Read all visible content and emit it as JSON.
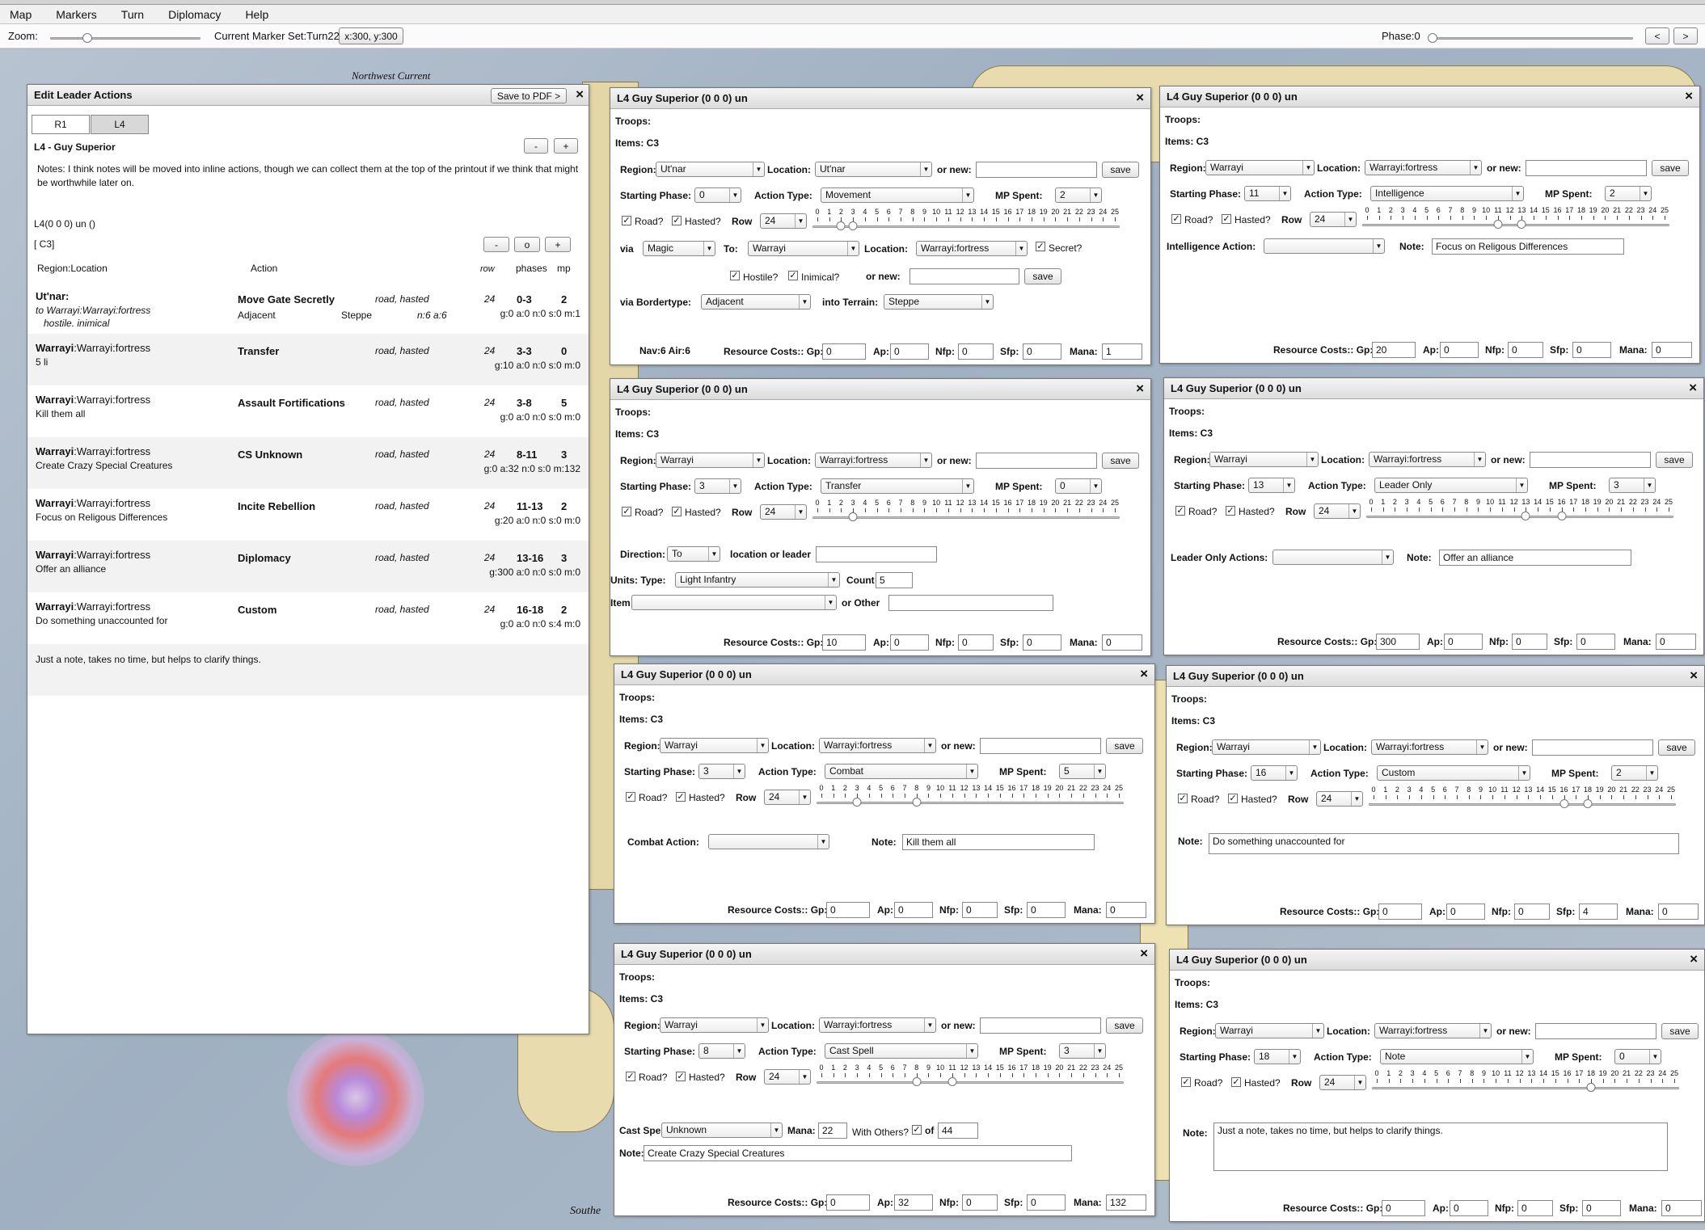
{
  "menu": [
    "Map",
    "Markers",
    "Turn",
    "Diplomacy",
    "Help"
  ],
  "toolbar": {
    "zoom_label": "Zoom:",
    "marker_set": "Current Marker Set:Turn22",
    "coords": "x:300, y:300",
    "phase_label": "Phase:0",
    "prev": "<",
    "next": ">"
  },
  "map_labels": {
    "current": "Northwest Current",
    "south": "Southe"
  },
  "leader": {
    "title": "Edit Leader Actions",
    "pdf": "Save to PDF >",
    "close": "×",
    "tabs": [
      "R1",
      "L4"
    ],
    "name": "L4 - Guy Superior",
    "minus": "-",
    "plus": "+",
    "notes": "Notes: I think notes will be moved into inline actions, though we can collect them at the top of the printout if we think that might be worthwhile later on.",
    "unit": "L4(0 0 0) un ()",
    "items": "[ C3]",
    "zero": "o",
    "hdr": {
      "region": "Region:",
      "location": "Location",
      "action": "Action",
      "row": "row",
      "phases": "phases",
      "mp": "mp"
    },
    "rows": [
      {
        "region": "Ut'nar:",
        "loc": "",
        "note": "to Warrayi:Warrayi:fortress",
        "extra": "hostile. inimical",
        "action": "Move Gate Secretly",
        "mods": "road, hasted",
        "row": "24",
        "phases": "0-3",
        "mp": "2",
        "sub1": "Adjacent",
        "sub2": "Steppe",
        "sub3": "n:6 a:6",
        "res": "g:0 a:0 n:0 s:0 m:1"
      },
      {
        "region": "Warrayi",
        "loc": ":Warrayi:fortress",
        "note": "5 li",
        "extra": "",
        "action": "Transfer",
        "mods": "road, hasted",
        "row": "24",
        "phases": "3-3",
        "mp": "0",
        "sub1": "",
        "sub2": "",
        "sub3": "",
        "res": "g:10 a:0 n:0 s:0 m:0"
      },
      {
        "region": "Warrayi",
        "loc": ":Warrayi:fortress",
        "note": "Kill them all",
        "extra": "",
        "action": "Assault Fortifications",
        "mods": "road, hasted",
        "row": "24",
        "phases": "3-8",
        "mp": "5",
        "sub1": "",
        "sub2": "",
        "sub3": "",
        "res": "g:0 a:0 n:0 s:0 m:0"
      },
      {
        "region": "Warrayi",
        "loc": ":Warrayi:fortress",
        "note": "Create Crazy Special Creatures",
        "extra": "",
        "action": "CS Unknown",
        "mods": "road, hasted",
        "row": "24",
        "phases": "8-11",
        "mp": "3",
        "sub1": "",
        "sub2": "",
        "sub3": "",
        "res": "g:0 a:32 n:0 s:0 m:132"
      },
      {
        "region": "Warrayi",
        "loc": ":Warrayi:fortress",
        "note": "Focus on Religous Differences",
        "extra": "",
        "action": "Incite Rebellion",
        "mods": "road, hasted",
        "row": "24",
        "phases": "11-13",
        "mp": "2",
        "sub1": "",
        "sub2": "",
        "sub3": "",
        "res": "g:20 a:0 n:0 s:0 m:0"
      },
      {
        "region": "Warrayi",
        "loc": ":Warrayi:fortress",
        "note": "Offer an alliance",
        "extra": "",
        "action": "Diplomacy",
        "mods": "road, hasted",
        "row": "24",
        "phases": "13-16",
        "mp": "3",
        "sub1": "",
        "sub2": "",
        "sub3": "",
        "res": "g:300 a:0 n:0 s:0 m:0"
      },
      {
        "region": "Warrayi",
        "loc": ":Warrayi:fortress",
        "note": "Do something unaccounted for",
        "extra": "",
        "action": "Custom",
        "mods": "road, hasted",
        "row": "24",
        "phases": "16-18",
        "mp": "2",
        "sub1": "",
        "sub2": "",
        "sub3": "",
        "res": "g:0 a:0 n:0 s:4 m:0"
      }
    ],
    "final_note": "Just a note, takes no time, but helps to clarify things."
  },
  "common": {
    "title": "L4 Guy Superior (0 0 0) un",
    "troops": "Troops:",
    "items": "Items:  C3",
    "region": "Region:",
    "location": "Location:",
    "ornew": "or new:",
    "save": "save",
    "starting": "Starting Phase:",
    "actiontype": "Action Type:",
    "mpspent": "MP Spent:",
    "road": "Road?",
    "hasted": "Hasted?",
    "row": "Row",
    "rowval": "24",
    "rescosts": "Resource Costs:: Gp:",
    "ap": "Ap:",
    "nfp": "Nfp:",
    "sfp": "Sfp:",
    "mana": "Mana:",
    "close": "×",
    "check": "✓"
  },
  "forms": [
    {
      "region": "Ut'nar",
      "location": "Ut'nar",
      "phase": "0",
      "type": "Movement",
      "mp": "2",
      "lo": 2,
      "hi": 3,
      "gp": "0",
      "ap": "0",
      "nfp": "0",
      "sfp": "0",
      "mana": "1",
      "via": "via",
      "via_val": "Magic",
      "to": "To:",
      "to_val": "Warrayi",
      "loc2": "Location:",
      "loc2_val": "Warrayi:fortress",
      "secret": "Secret?",
      "hostile": "Hostile?",
      "inimical": "Inimical?",
      "ornew2": "or new:",
      "bordertype": "via Bordertype:",
      "border_val": "Adjacent",
      "terrain": "into Terrain:",
      "terrain_val": "Steppe",
      "navair": "Nav:6   Air:6"
    },
    {
      "region": "Warrayi",
      "location": "Warrayi:fortress",
      "phase": "11",
      "type": "Intelligence",
      "mp": "2",
      "lo": 11,
      "hi": 13,
      "gp": "20",
      "ap": "0",
      "nfp": "0",
      "sfp": "0",
      "mana": "0",
      "sub_label": "Intelligence Action:",
      "note_label": "Note:",
      "note_val": "Focus on Religous Differences"
    },
    {
      "region": "Warrayi",
      "location": "Warrayi:fortress",
      "phase": "3",
      "type": "Transfer",
      "mp": "0",
      "lo": 3,
      "hi": 3,
      "gp": "10",
      "ap": "0",
      "nfp": "0",
      "sfp": "0",
      "mana": "0",
      "direction": "Direction:",
      "dir_val": "To",
      "locleader": "location or leader",
      "units": "Units:  Type:",
      "unit_type": "Light Infantry",
      "count": "Count",
      "count_val": "5",
      "item": "Item",
      "orother": "or Other"
    },
    {
      "region": "Warrayi",
      "location": "Warrayi:fortress",
      "phase": "13",
      "type": "Leader Only",
      "mp": "3",
      "lo": 13,
      "hi": 16,
      "gp": "300",
      "ap": "0",
      "nfp": "0",
      "sfp": "0",
      "mana": "0",
      "sub_label": "Leader Only Actions:",
      "note_label": "Note:",
      "note_val": "Offer an alliance"
    },
    {
      "region": "Warrayi",
      "location": "Warrayi:fortress",
      "phase": "3",
      "type": "Combat",
      "mp": "5",
      "lo": 3,
      "hi": 8,
      "gp": "0",
      "ap": "0",
      "nfp": "0",
      "sfp": "0",
      "mana": "0",
      "sub_label": "Combat Action:",
      "note_label": "Note:",
      "note_val": "Kill them all"
    },
    {
      "region": "Warrayi",
      "location": "Warrayi:fortress",
      "phase": "16",
      "type": "Custom",
      "mp": "2",
      "lo": 16,
      "hi": 18,
      "gp": "0",
      "ap": "0",
      "nfp": "0",
      "sfp": "4",
      "mana": "0",
      "note_label": "Note:",
      "note_val": "Do something unaccounted for"
    },
    {
      "region": "Warrayi",
      "location": "Warrayi:fortress",
      "phase": "8",
      "type": "Cast Spell",
      "mp": "3",
      "lo": 8,
      "hi": 11,
      "gp": "0",
      "ap": "32",
      "nfp": "0",
      "sfp": "0",
      "mana": "132",
      "spell_label": "Cast Spell:",
      "spell_val": "Unknown",
      "mana_label": "Mana:",
      "mana_val": "22",
      "withothers": "With Others?",
      "of": "of",
      "of_val": "44",
      "note_label": "Note:",
      "note_val": "Create Crazy Special Creatures"
    },
    {
      "region": "Warrayi",
      "location": "Warrayi:fortress",
      "phase": "18",
      "type": "Note",
      "mp": "0",
      "lo": 18,
      "hi": 18,
      "gp": "0",
      "ap": "0",
      "nfp": "0",
      "sfp": "0",
      "mana": "0",
      "note_label": "Note:",
      "note_val": "Just a note, takes no time, but helps to clarify things."
    }
  ]
}
